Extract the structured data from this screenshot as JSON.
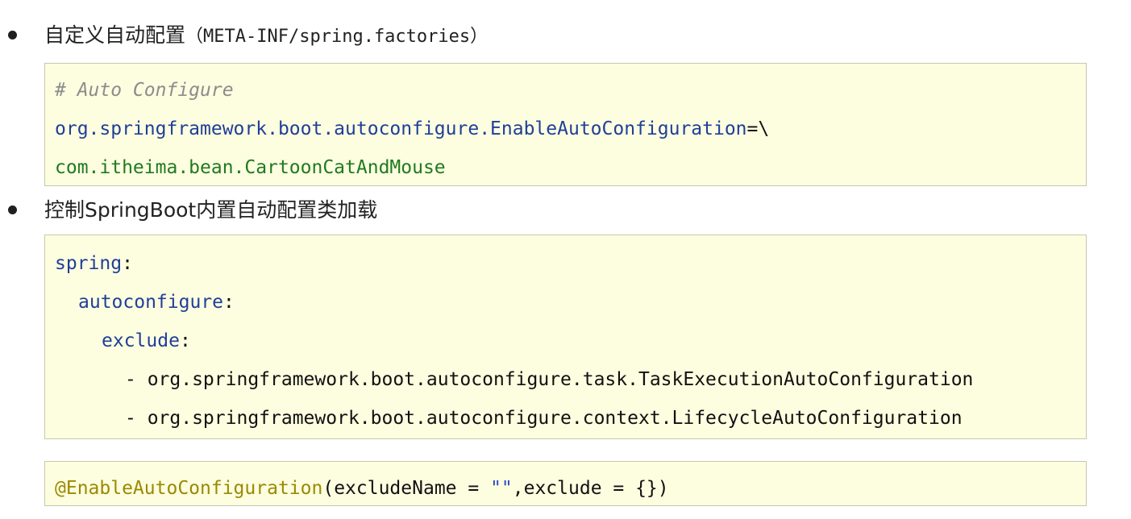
{
  "section1": {
    "label_cn": "自定义自动配置",
    "label_paren": "（META-INF/spring.factories）",
    "code": {
      "comment": "# Auto Configure",
      "key": "org.springframework.boot.autoconfigure.EnableAutoConfiguration",
      "key_suffix": "=\\",
      "value": "com.itheima.bean.CartoonCatAndMouse"
    }
  },
  "section2": {
    "label": "控制SpringBoot内置自动配置类加载",
    "yaml": {
      "spring_key": "spring",
      "autoconfigure_key": "autoconfigure",
      "exclude_key": "exclude",
      "colon": ":",
      "items": [
        "- org.springframework.boot.autoconfigure.task.TaskExecutionAutoConfiguration",
        "- org.springframework.boot.autoconfigure.context.LifecycleAutoConfiguration"
      ]
    }
  },
  "section3": {
    "annotation": "@EnableAutoConfiguration",
    "args_open": "(excludeName = ",
    "string_value": "\"\"",
    "args_close": ",exclude = {})"
  },
  "colors": {
    "code_background": "#fdfde0",
    "comment": "#8c8c8c",
    "key": "#1f3f99",
    "value": "#207a20",
    "annotation": "#9a8a00"
  }
}
